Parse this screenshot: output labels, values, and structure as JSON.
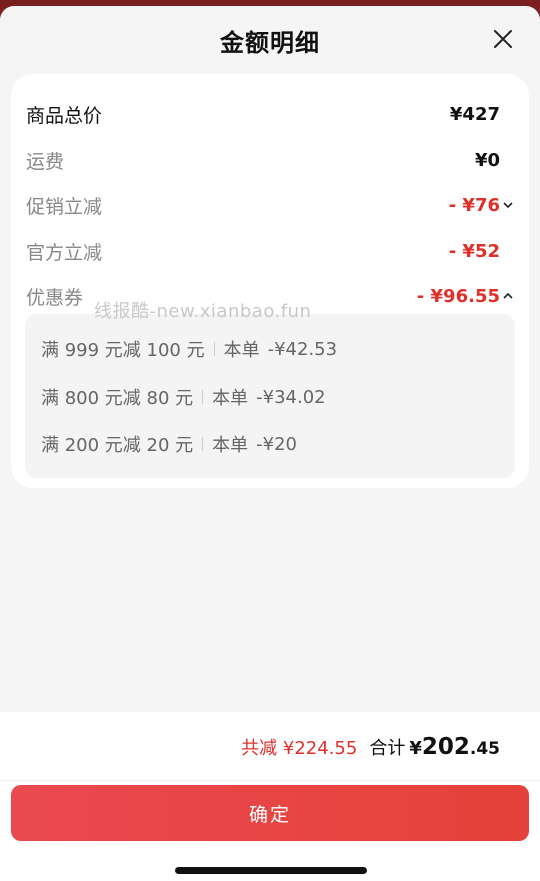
{
  "header": {
    "title": "金额明细"
  },
  "watermark": "线报酷-new.xianbao.fun",
  "rows": [
    {
      "label": "商品总价",
      "value": "¥427"
    },
    {
      "label": "运费",
      "value": "¥0"
    },
    {
      "label": "促销立减",
      "value": "- ¥76"
    },
    {
      "label": "官方立减",
      "value": "- ¥52"
    },
    {
      "label": "优惠券",
      "value": "- ¥96.55"
    }
  ],
  "coupons": [
    {
      "rule": "满 999 元减 100 元",
      "tag": "本单",
      "amount": "-¥42.53"
    },
    {
      "rule": "满 800 元减 80 元",
      "tag": "本单",
      "amount": "-¥34.02"
    },
    {
      "rule": "满 200 元减 20 元",
      "tag": "本单",
      "amount": "-¥20"
    }
  ],
  "totals": {
    "reduced": "共减 ¥224.55",
    "label": "合计",
    "yen": "¥",
    "integer": "202",
    "decimal": ".45"
  },
  "confirm_label": "确定",
  "colors": {
    "accent": "#e0302a",
    "button": "#e6413a"
  }
}
